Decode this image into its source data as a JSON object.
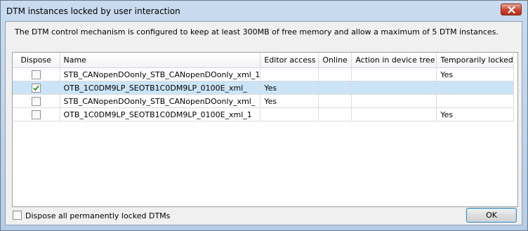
{
  "window": {
    "title": "DTM instances locked by user interaction",
    "close_icon": "close-icon"
  },
  "description": "The DTM control mechanism is configured to keep at least 300MB of free memory and allow a maximum of 5 DTM instances.",
  "table": {
    "columns": [
      "Dispose",
      "Name",
      "Editor access",
      "Online",
      "Action in device tree",
      "Temporarily locked"
    ],
    "rows": [
      {
        "dispose": false,
        "name": "STB_CANopenDOonly_STB_CANopenDOonly_xml_1",
        "editor_access": "",
        "online": "",
        "action": "",
        "temp_locked": "Yes",
        "selected": false
      },
      {
        "dispose": true,
        "name": "OTB_1C0DM9LP_SEOTB1C0DM9LP_0100E_xml_",
        "editor_access": "Yes",
        "online": "",
        "action": "",
        "temp_locked": "",
        "selected": true
      },
      {
        "dispose": false,
        "name": "STB_CANopenDOonly_STB_CANopenDOonly_xml_",
        "editor_access": "Yes",
        "online": "",
        "action": "",
        "temp_locked": "",
        "selected": false
      },
      {
        "dispose": false,
        "name": "OTB_1C0DM9LP_SEOTB1C0DM9LP_0100E_xml_1",
        "editor_access": "",
        "online": "",
        "action": "",
        "temp_locked": "Yes",
        "selected": false
      }
    ]
  },
  "dispose_all": {
    "label": "Dispose all permanently locked DTMs",
    "checked": false
  },
  "ok_label": "OK",
  "colors": {
    "selection": "#cce4f7",
    "check": "#3a8a2a"
  }
}
